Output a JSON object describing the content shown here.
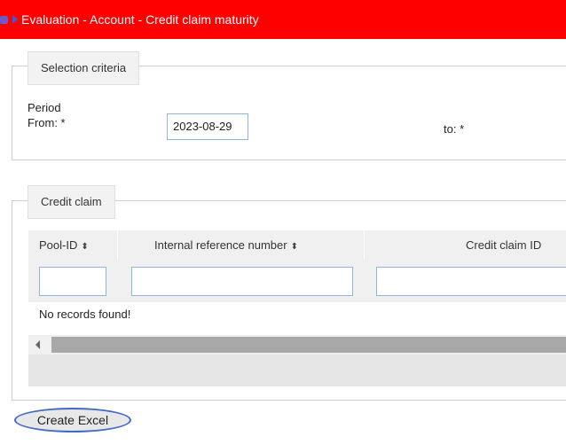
{
  "header": {
    "title": "Evaluation - Account - Credit claim maturity",
    "home_icon": "home-icon",
    "arrow_icon": "arrow-right-icon",
    "background_color": "#ff0000"
  },
  "selection_criteria": {
    "legend": "Selection criteria",
    "period_label": "Period",
    "from_label": "From: *",
    "from_value": "2023-08-29",
    "to_label": "to: *"
  },
  "credit_claim": {
    "legend": "Credit claim",
    "columns": [
      {
        "label": "Pool-ID",
        "sortable": true
      },
      {
        "label": "Internal reference number",
        "sortable": true
      },
      {
        "label": "Credit claim ID",
        "sortable": false
      }
    ],
    "sort_icon": "⬍",
    "empty_message": "No records found!"
  },
  "actions": {
    "create_excel_label": "Create Excel"
  }
}
